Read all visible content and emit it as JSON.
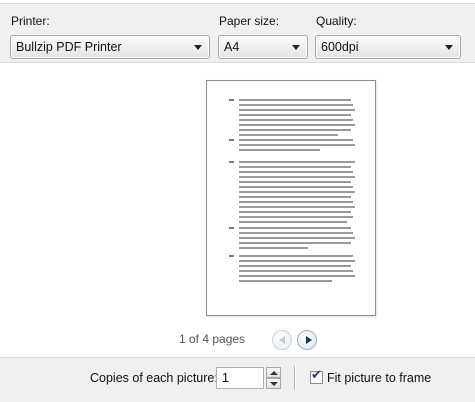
{
  "printer": {
    "label": "Printer:",
    "value": "Bullzip PDF Printer"
  },
  "paper": {
    "label": "Paper size:",
    "value": "A4"
  },
  "quality": {
    "label": "Quality:",
    "value": "600dpi"
  },
  "preview": {
    "page_status": "1 of 4 pages",
    "prev_icon": "arrow-left-icon",
    "next_icon": "arrow-right-icon"
  },
  "copies": {
    "label": "Copies of each picture:",
    "value": "1"
  },
  "fit": {
    "label": "Fit picture to frame",
    "checked": true
  }
}
